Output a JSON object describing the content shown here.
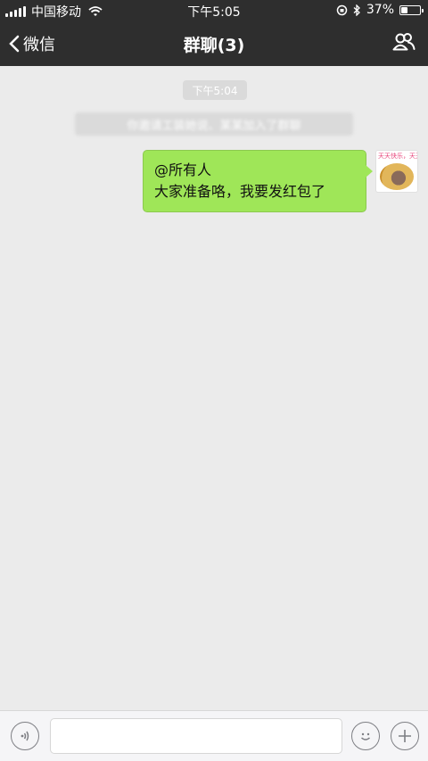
{
  "status_bar": {
    "carrier": "中国移动",
    "time": "下午5:05",
    "battery_percent": "37%",
    "battery_level": 0.37,
    "icons": [
      "signal-icon",
      "wifi-icon",
      "rotation-lock-icon",
      "bluetooth-icon",
      "battery-icon"
    ]
  },
  "nav": {
    "back_label": "微信",
    "title": "群聊(3)",
    "contacts_icon": "group-contacts-icon"
  },
  "chat": {
    "timestamp": "下午5:04",
    "system_note": "你邀请工装她说、某某加入了群聊",
    "messages": [
      {
        "sender": "self",
        "lines": [
          "@所有人",
          "大家准备咯，我要发红包了"
        ],
        "avatar_caption": "天天快乐，天天开心!"
      }
    ]
  },
  "input_bar": {
    "voice_icon": "voice-icon",
    "text_value": "",
    "emoji_icon": "emoji-icon",
    "plus_icon": "plus-icon"
  },
  "colors": {
    "nav_bg": "#2e2e2e",
    "chat_bg": "#ebebeb",
    "bubble_green": "#9fe658",
    "timestamp_bg": "#dadada"
  }
}
